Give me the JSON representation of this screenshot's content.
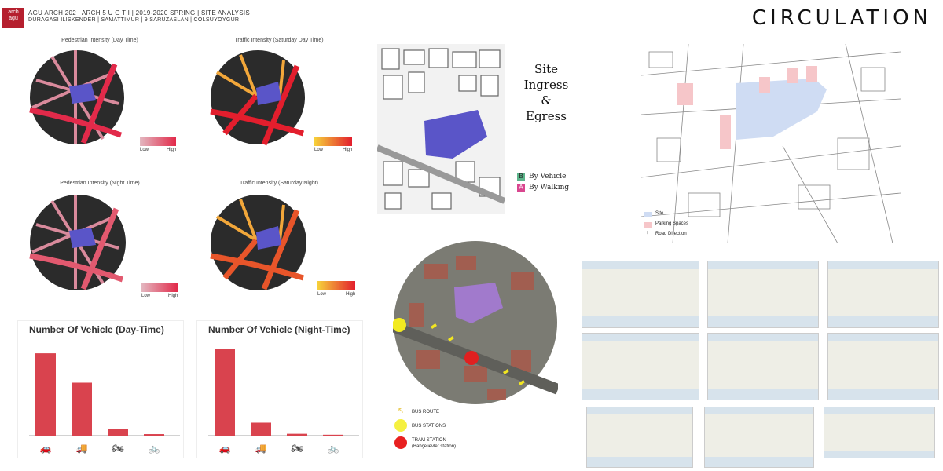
{
  "header": {
    "logo_line1": "arch",
    "logo_line2": "agu",
    "line1": "AGU ARCH 202 | ARCH 5 U G T I | 2019-2020 SPRING | SITE ANALYSIS",
    "line2": "DURAGASI ILISKENDER | SAMATTIMUR | 9 SARUZASLAN | COLSUYOYGUR",
    "title": "CIRCULATION"
  },
  "intensity_maps": [
    {
      "title": "Pedestrian Intensity (Day Time)",
      "low": "Low",
      "high": "High",
      "color_low": "#e3b7c0",
      "color_high": "#e22a4a"
    },
    {
      "title": "Traffic Intensity (Saturday Day Time)",
      "low": "Low",
      "high": "High",
      "color_low": "#f6d23a",
      "color_high": "#e31e2d"
    },
    {
      "title": "Pedestrian Intensity (Night Time)",
      "low": "Low",
      "high": "High",
      "color_low": "#e3b7c0",
      "color_high": "#e22a4a"
    },
    {
      "title": "Traffic Intensity (Saturday Night)",
      "low": "Low",
      "high": "High",
      "color_low": "#f6d23a",
      "color_high": "#e31e2d"
    }
  ],
  "chart_data": [
    {
      "type": "bar",
      "title": "Number Of Vehicle (Day-Time)",
      "categories": [
        "car-icon",
        "truck-icon",
        "motorcycle-icon",
        "bicycle-icon"
      ],
      "values": [
        160,
        103,
        13,
        3
      ],
      "ylim": [
        0,
        180
      ],
      "color": "#d9434e",
      "grid": false
    },
    {
      "type": "bar",
      "title": "Number Of Vehicle (Night-Time)",
      "categories": [
        "car-icon",
        "truck-icon",
        "motorcycle-icon",
        "bicycle-icon"
      ],
      "values": [
        188,
        28,
        4,
        2
      ],
      "ylim": [
        0,
        200
      ],
      "color": "#d9434e",
      "grid": false
    }
  ],
  "site_ingress": {
    "title_line1": "Site Ingress",
    "title_line2": "&",
    "title_line3": "Egress",
    "legend": [
      {
        "key": "B",
        "label": "By Vehicle",
        "color": "#5bb48a"
      },
      {
        "key": "A",
        "label": "By Walking",
        "color": "#d9468f"
      }
    ]
  },
  "parking_legend": {
    "site": "Site",
    "parking": "Parking Spaces",
    "road": "Road Direction",
    "site_color": "#cfdcf3",
    "parking_color": "#f6c6c9"
  },
  "transit_legend": {
    "bus_route": "BUS ROUTE",
    "bus_stations": "BUS STATIONS",
    "tram_station": "TRAM STATION",
    "tram_station_name": "(Bahçelievler station)"
  }
}
